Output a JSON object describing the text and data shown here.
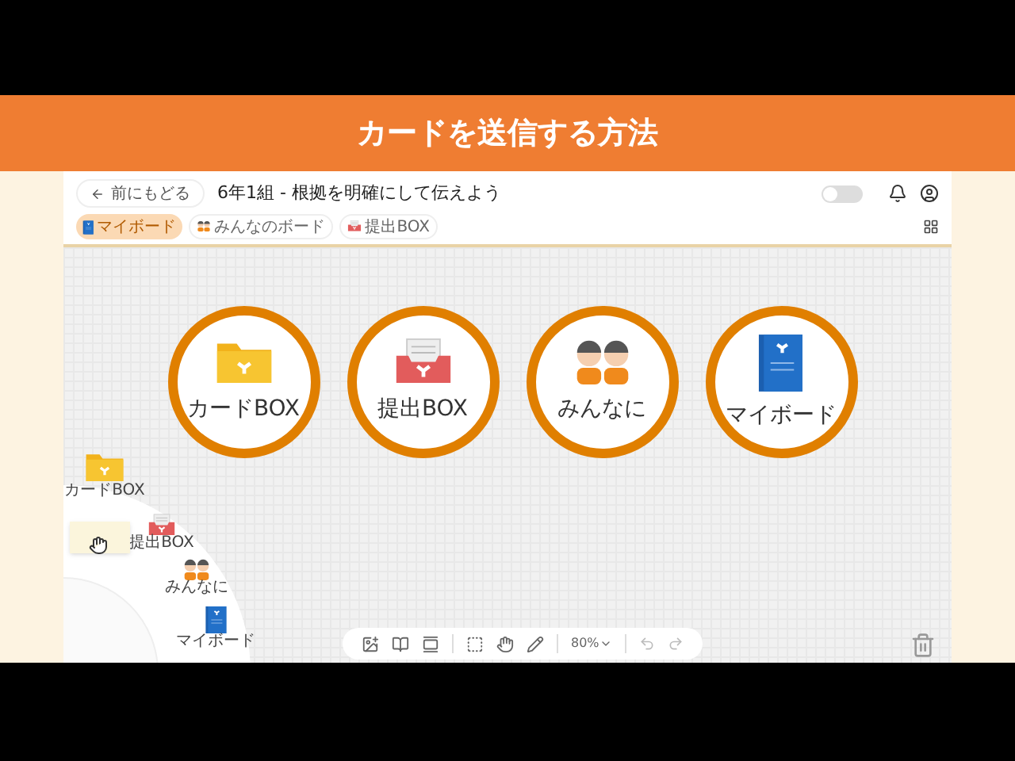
{
  "banner": {
    "title": "カードを送信する方法"
  },
  "header": {
    "back_label": "前にもどる",
    "title": "6年1組 - 根拠を明確にして伝えよう",
    "toggle": {
      "on": false
    }
  },
  "tabs": [
    {
      "label": "マイボード",
      "selected": true,
      "kind": "book"
    },
    {
      "label": "みんなのボード",
      "selected": false,
      "kind": "people"
    },
    {
      "label": "提出BOX",
      "selected": false,
      "kind": "tray"
    }
  ],
  "destinations": [
    {
      "label": "カードBOX",
      "kind": "folder"
    },
    {
      "label": "提出BOX",
      "kind": "tray"
    },
    {
      "label": "みんなに",
      "kind": "people"
    },
    {
      "label": "マイボード",
      "kind": "book"
    }
  ],
  "radial_menu": [
    {
      "label": "カードBOX",
      "kind": "folder"
    },
    {
      "label": "提出BOX",
      "kind": "tray"
    },
    {
      "label": "みんなに",
      "kind": "people"
    },
    {
      "label": "マイボード",
      "kind": "book"
    }
  ],
  "toolbar": {
    "zoom": "80%"
  }
}
